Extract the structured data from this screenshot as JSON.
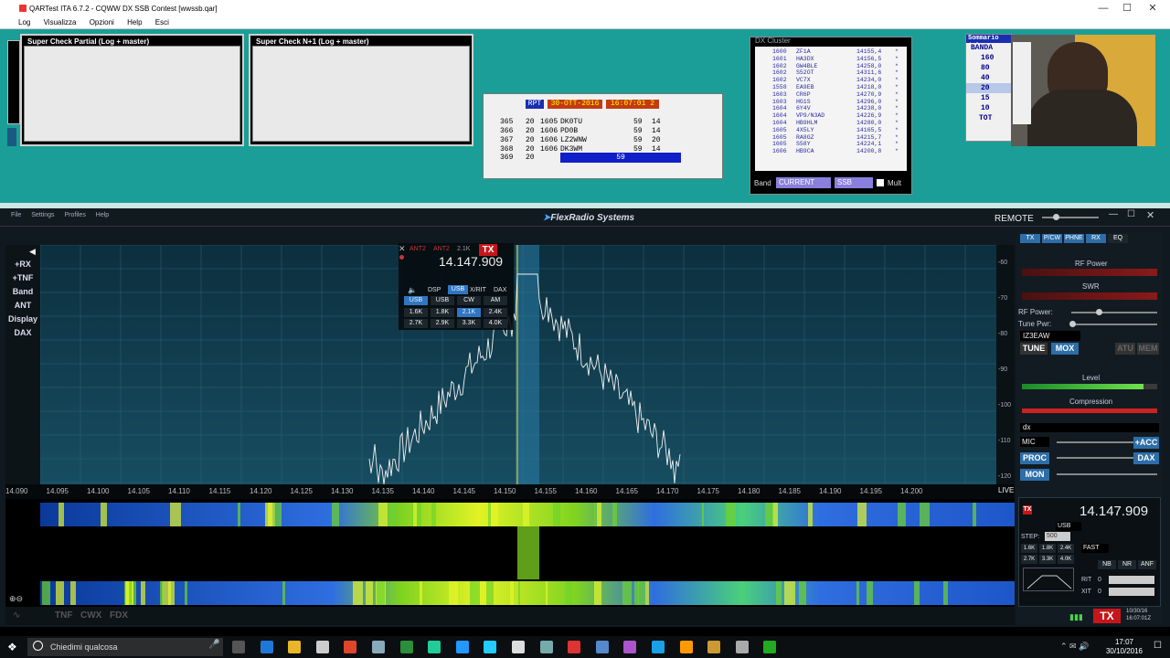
{
  "qartest": {
    "title": "QARTest ITA 6.7.2 - CQWW DX SSB Contest [wwssb.qar]",
    "menu": [
      "Log",
      "Visualizza",
      "Opzioni",
      "Help",
      "Esci"
    ],
    "scp_title": "Super Check Partial (Log + master)",
    "scn1_title": "Super Check N+1 (Log + master)",
    "log_header": {
      "rpt": "RPT",
      "date": "30-OTT-2016",
      "time": "16:07:01 2"
    },
    "log_rows": [
      {
        "nr": "365",
        "band": "20",
        "time": "1605",
        "call": "DK0TU",
        "rst": "59",
        "zone": "14"
      },
      {
        "nr": "366",
        "band": "20",
        "time": "1606",
        "call": "PD0B",
        "rst": "59",
        "zone": "14"
      },
      {
        "nr": "367",
        "band": "20",
        "time": "1606",
        "call": "LZ2WNW",
        "rst": "59",
        "zone": "20"
      },
      {
        "nr": "368",
        "band": "20",
        "time": "1606",
        "call": "DK3WM",
        "rst": "59",
        "zone": "14"
      }
    ],
    "log_entry": {
      "nr": "369",
      "band": "20",
      "rst": "59"
    },
    "dx_cluster": {
      "title": "DX Cluster",
      "rows": [
        [
          "1600",
          "ZF1A",
          "14155,4"
        ],
        [
          "1601",
          "HA3DX",
          "14156,5"
        ],
        [
          "1602",
          "GW4BLE",
          "14258,0"
        ],
        [
          "1602",
          "S52OT",
          "14311,6"
        ],
        [
          "1602",
          "VC7X",
          "14234,0"
        ],
        [
          "1558",
          "EA9EB",
          "14218,0"
        ],
        [
          "1603",
          "CR6P",
          "14270,9"
        ],
        [
          "1603",
          "HG1S",
          "14296,0"
        ],
        [
          "1604",
          "6Y4V",
          "14238,0"
        ],
        [
          "1604",
          "VP9/N3AD",
          "14226,9"
        ],
        [
          "1604",
          "HB9HLM",
          "14280,0"
        ],
        [
          "1605",
          "4X5LY",
          "14165,5"
        ],
        [
          "1605",
          "RA8GZ",
          "14215,7"
        ],
        [
          "1605",
          "S58Y",
          "14224,1"
        ],
        [
          "1606",
          "HB9CA",
          "14200,8"
        ]
      ],
      "band_label": "Band",
      "band_value": "CURRENT",
      "mode_value": "SSB",
      "mult_label": "Mult"
    },
    "summary": {
      "title": "Sommario (Al",
      "header": "BANDA",
      "bands": [
        "160",
        "80",
        "40",
        "20",
        "15",
        "10"
      ],
      "total": "TOT"
    }
  },
  "flex": {
    "menu": [
      "File",
      "Settings",
      "Profiles",
      "Help"
    ],
    "brand": "FlexRadio Systems",
    "remote": "REMOTE",
    "left_buttons": [
      "+RX",
      "+TNF",
      "Band",
      "ANT",
      "Display",
      "DAX"
    ],
    "slice": {
      "freq": "14.147.909",
      "tx": "TX",
      "ant": "ANT2",
      "ant2": "ANT2",
      "bw": "2.1K",
      "tabs": [
        "DSP",
        "USB",
        "X/RIT",
        "DAX"
      ],
      "modes": [
        "USB",
        "USB",
        "CW",
        "AM"
      ],
      "filters": [
        "1.6K",
        "1.8K",
        "2.1K",
        "2.4K",
        "2.7K",
        "2.9K",
        "3.3K",
        "4.0K"
      ]
    },
    "freq_ticks": [
      "14.090",
      "14.095",
      "14.100",
      "14.105",
      "14.110",
      "14.115",
      "14.120",
      "14.125",
      "14.130",
      "14.135",
      "14.140",
      "14.145",
      "14.150",
      "14.155",
      "14.160",
      "14.165",
      "14.170",
      "14.175",
      "14.180",
      "14.185",
      "14.190",
      "14.195",
      "14.200"
    ],
    "live": "LIVE",
    "db_ticks": [
      "-60",
      "-70",
      "-80",
      "-90",
      "-100",
      "-110",
      "-120"
    ],
    "bottom_labels": [
      "TNF",
      "CWX",
      "FDX"
    ],
    "right": {
      "tabs": [
        "TX",
        "P/CW",
        "PHNE",
        "RX",
        "EQ"
      ],
      "rf_power": "RF Power",
      "swr": "SWR",
      "rf_power_slider": "RF Power:",
      "tune_pwr": "Tune Pwr:",
      "profile": "IZ3EAW",
      "tune": "TUNE",
      "mox": "MOX",
      "atu": "ATU",
      "mem": "MEM",
      "level": "Level",
      "compression": "Compression",
      "dx": "dx",
      "mic": "MIC",
      "acc": "+ACC",
      "proc": "PROC",
      "dax": "DAX",
      "mon": "MON",
      "freq2": "14.147.909",
      "step_label": "STEP:",
      "step": "500",
      "mode2": "USB",
      "agc": "FAST",
      "filters2": [
        "1.6K",
        "1.8K",
        "2.4K",
        "2.7K",
        "3.3K",
        "4.0K"
      ],
      "dsp": [
        "NB",
        "NR",
        "ANF"
      ],
      "rit": "RIT",
      "xit": "XIT",
      "zero": "0",
      "tx_big": "TX",
      "date": "10/30/16",
      "utc": "16:07:01Z"
    }
  },
  "taskbar": {
    "search": "Chiedimi qualcosa",
    "time": "17:07",
    "date": "30/10/2016"
  }
}
